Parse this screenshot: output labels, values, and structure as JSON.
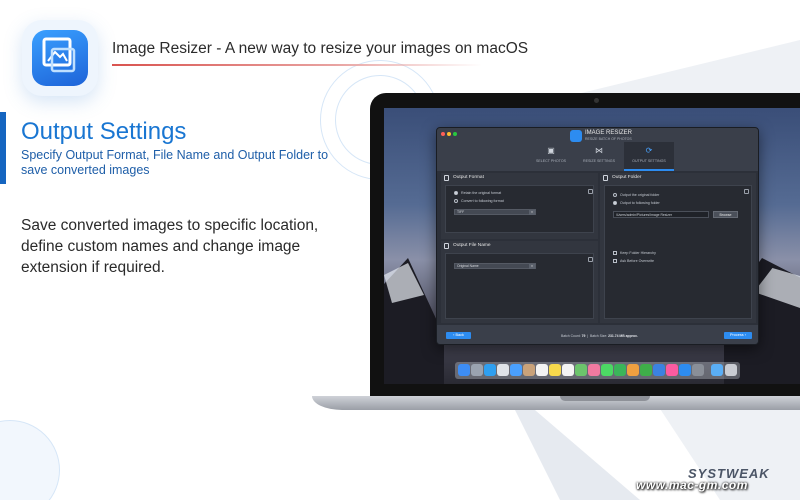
{
  "header": {
    "tagline": "Image Resizer - A new way to resize your images on macOS"
  },
  "feature": {
    "title": "Output Settings",
    "subtitle": "Specify Output Format, File Name and Output Folder to save converted images",
    "description": "Save converted images to specific location, define custom names and change image extension if required."
  },
  "app_window": {
    "title": "IMAGE RESIZER",
    "subtitle": "RESIZE BATCH OF PHOTOS",
    "steps": [
      {
        "label": "SELECT PHOTOS",
        "icon": "crop-icon",
        "active": false
      },
      {
        "label": "RESIZE SETTINGS",
        "icon": "resize-icon",
        "active": false
      },
      {
        "label": "OUTPUT SETTINGS",
        "icon": "output-icon",
        "active": true
      }
    ],
    "output_format": {
      "title": "Output Format",
      "options": [
        "Retain the original format",
        "Convert to following format"
      ],
      "selected_option": "Retain the original format",
      "format_value": "TIFF"
    },
    "output_file_name": {
      "title": "Output File Name",
      "value": "Original Name"
    },
    "output_folder": {
      "title": "Output Folder",
      "options": [
        "Output the original folder",
        "Output to following folder"
      ],
      "selected_option": "Output to following folder",
      "path": "/Users/admin/Pictures/Image Resizer",
      "browse_label": "Browse",
      "checkboxes": [
        "Keep Folder Hierarchy",
        "Ask Before Overwrite"
      ]
    },
    "footer": {
      "back_label": "Back",
      "process_label": "Process",
      "batch_count_label": "Batch Count:",
      "batch_count_value": "79",
      "batch_size_label": "Batch Size:",
      "batch_size_value": "231.74 MB approx."
    }
  },
  "brand": {
    "name": "SYSTWEAK",
    "watermark": "www.mac-gm.com"
  },
  "colors": {
    "accent": "#1976d2",
    "app_blue": "#2d8cf0",
    "underline": "#d9534f"
  }
}
